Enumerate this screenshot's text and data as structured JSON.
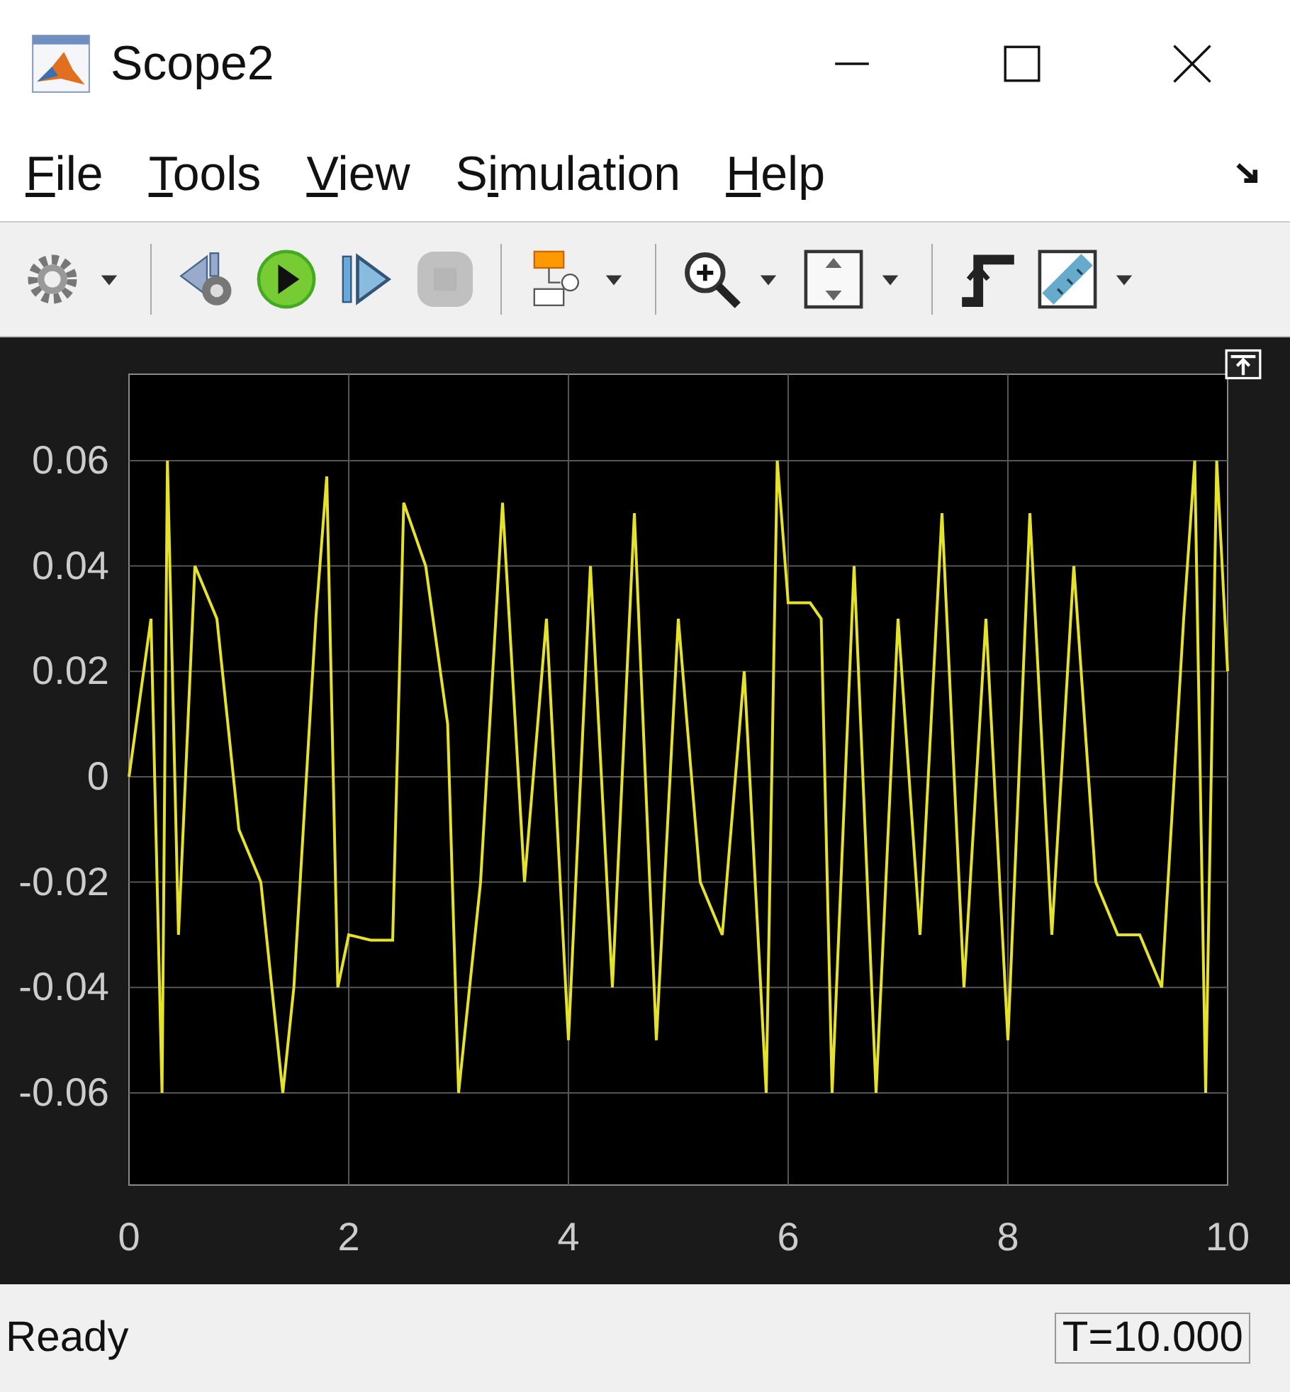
{
  "window": {
    "title": "Scope2"
  },
  "menu": [
    {
      "key": "F",
      "rest": "ile"
    },
    {
      "key": "T",
      "rest": "ools"
    },
    {
      "key": "V",
      "rest": "iew"
    },
    {
      "lead": "S",
      "key": "i",
      "rest": "mulation"
    },
    {
      "key": "H",
      "rest": "elp"
    }
  ],
  "toolbar": [
    {
      "kind": "gear",
      "dropdown": true,
      "disabled": false
    },
    {
      "kind": "sep"
    },
    {
      "kind": "step-back",
      "dropdown": false,
      "disabled": false
    },
    {
      "kind": "run",
      "dropdown": false,
      "disabled": false
    },
    {
      "kind": "step-forward",
      "dropdown": false,
      "disabled": false
    },
    {
      "kind": "stop",
      "dropdown": false,
      "disabled": true
    },
    {
      "kind": "sep"
    },
    {
      "kind": "blocks",
      "dropdown": true,
      "disabled": false
    },
    {
      "kind": "sep"
    },
    {
      "kind": "zoom",
      "dropdown": true,
      "disabled": false
    },
    {
      "kind": "autoscale",
      "dropdown": true,
      "disabled": false
    },
    {
      "kind": "sep"
    },
    {
      "kind": "trigger",
      "dropdown": false,
      "disabled": false
    },
    {
      "kind": "ruler",
      "dropdown": true,
      "disabled": false
    }
  ],
  "plot": {
    "chart_data": {
      "type": "line",
      "grid": true,
      "xlim": [
        0,
        10
      ],
      "ylim": [
        -0.0775,
        0.0764
      ],
      "xticks": [
        0,
        2,
        4,
        6,
        8,
        10
      ],
      "yticks": [
        0.06,
        0.04,
        0.02,
        0,
        -0.02,
        -0.04,
        -0.06
      ],
      "x": [
        0,
        0.2,
        0.3,
        0.35,
        0.45,
        0.6,
        0.8,
        1.0,
        1.2,
        1.4,
        1.5,
        1.7,
        1.8,
        1.9,
        2.0,
        2.2,
        2.4,
        2.5,
        2.7,
        2.9,
        3.0,
        3.2,
        3.4,
        3.6,
        3.8,
        4.0,
        4.2,
        4.4,
        4.6,
        4.8,
        5.0,
        5.2,
        5.4,
        5.6,
        5.8,
        5.9,
        6.0,
        6.2,
        6.3,
        6.4,
        6.6,
        6.8,
        7.0,
        7.2,
        7.4,
        7.6,
        7.8,
        8.0,
        8.2,
        8.4,
        8.6,
        8.8,
        9.0,
        9.2,
        9.4,
        9.6,
        9.7,
        9.8,
        9.9,
        10.0
      ],
      "series": [
        {
          "color": "#e6e22a",
          "values": [
            0,
            0.03,
            -0.06,
            0.06,
            -0.03,
            0.04,
            0.03,
            -0.01,
            -0.02,
            -0.06,
            -0.04,
            0.03,
            0.057,
            -0.04,
            -0.03,
            -0.031,
            -0.031,
            0.052,
            0.04,
            0.01,
            -0.06,
            -0.02,
            0.052,
            -0.02,
            0.03,
            -0.05,
            0.04,
            -0.04,
            0.05,
            -0.05,
            0.03,
            -0.02,
            -0.03,
            0.02,
            -0.06,
            0.06,
            0.033,
            0.033,
            0.03,
            -0.06,
            0.04,
            -0.06,
            0.03,
            -0.03,
            0.05,
            -0.04,
            0.03,
            -0.05,
            0.05,
            -0.03,
            0.04,
            -0.02,
            -0.03,
            -0.03,
            -0.04,
            0.03,
            0.06,
            -0.06,
            0.06,
            0.02
          ]
        }
      ]
    }
  },
  "status_bar": {
    "text": "Ready",
    "time": "T=10.000"
  }
}
